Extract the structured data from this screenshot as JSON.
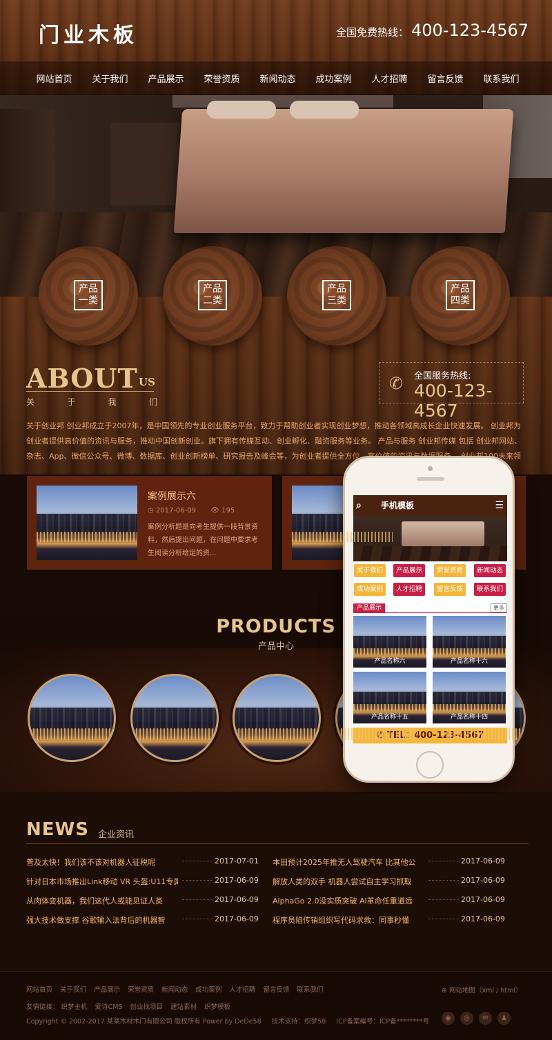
{
  "header": {
    "logo": "门业木板",
    "hotline_label": "全国免费热线：",
    "hotline_number": "400-123-4567"
  },
  "nav": [
    "网站首页",
    "关于我们",
    "产品展示",
    "荣誉资质",
    "新闻动态",
    "成功案例",
    "人才招聘",
    "留言反馈",
    "联系我们"
  ],
  "categories": [
    {
      "line1": "产品",
      "line2": "一类"
    },
    {
      "line1": "产品",
      "line2": "二类"
    },
    {
      "line1": "产品",
      "line2": "三类"
    },
    {
      "line1": "产品",
      "line2": "四类"
    }
  ],
  "about": {
    "title": "ABOUT",
    "title_suffix": "US",
    "subtitle": [
      "关",
      "于",
      "我",
      "们"
    ],
    "service_label": "全国服务热线:",
    "service_number": "400-123-4567",
    "text": "关于创业邦 创业邦成立于2007年，是中国领先的专业创业服务平台，致力于帮助创业者实现创业梦想，推动各领域高成长企业快速发展。 创业邦为创业者提供高价值的资讯与服务，推动中国创新创业。旗下拥有传媒互动、创业孵化、融资服务等业务。 产品与服务 创业邦传媒 包括 创业邦网站、杂志、App、微信公众号、微博、数据库、创业创新榜单、研究报告及峰会等，为创业者提供全方位、高价值的资讯与数据服务。 创业邦100未来领袖峰"
  },
  "cases": [
    {
      "title": "案例展示六",
      "date": "2017-06-09",
      "views": "195",
      "desc": "案例分析题是向考生提供一段背景资料，然后提出问题，在问题中要求考生阅读分析给定的资..."
    }
  ],
  "products": {
    "title": "PRODUCTS",
    "subtitle": "产品中心"
  },
  "mobile": {
    "title": "手机模板",
    "nav": [
      "关于我们",
      "产品展示",
      "荣誉资质",
      "新闻动态",
      "成功案例",
      "人才招聘",
      "留言反馈",
      "联系我们"
    ],
    "section": "产品展示",
    "more": "更多",
    "products": [
      "产品名称六",
      "产品名称十六",
      "产品名称十五",
      "产品名称十四"
    ],
    "tel": "TEL：400-123-4567"
  },
  "news": {
    "title": "NEWS",
    "subtitle": "企业资讯",
    "left": [
      {
        "title": "普及太快！我们该不该对机器人征税呢",
        "date": "2017-07-01"
      },
      {
        "title": "针对日本市场推出Link移动 VR 头盔:U11专属",
        "date": "2017-06-09"
      },
      {
        "title": "从肉体变机器，我们这代人或能见证人类",
        "date": "2017-06-09"
      },
      {
        "title": "强大技术做支撑 谷歌输入法背后的机器智",
        "date": "2017-06-09"
      }
    ],
    "right": [
      {
        "title": "本田预计2025年推无人驾驶汽车 比其他公",
        "date": "2017-06-09"
      },
      {
        "title": "解放人类的双手 机器人尝试自主学习抓取",
        "date": "2017-06-09"
      },
      {
        "title": "AlphaGo 2.0没实质突破 AI革命任重道远",
        "date": "2017-06-09"
      },
      {
        "title": "程序员陷传销组织写代码求救：同事秒懂",
        "date": "2017-06-09"
      }
    ]
  },
  "footer": {
    "links": [
      "网站首页",
      "关于我们",
      "产品展示",
      "荣誉资质",
      "新闻动态",
      "成功案例",
      "人才招聘",
      "留言反馈",
      "联系我们"
    ],
    "friend_label": "友情链接：",
    "friends": [
      "织梦主机",
      "爱诗CMS",
      "创业找项目",
      "建站素材",
      "织梦模板"
    ],
    "copyright": "Copyright © 2002-2017 某某木材木门有限公司 版权所有 Power by DeDe58",
    "support": "技术支持：织梦58",
    "icp": "ICP备案编号：ICP备********号",
    "sitemap": "网站地图（xml / html）"
  },
  "colors": {
    "accent": "#e8c58e",
    "mobile_red": "#c81e46",
    "mobile_yellow": "#f4b53b"
  }
}
